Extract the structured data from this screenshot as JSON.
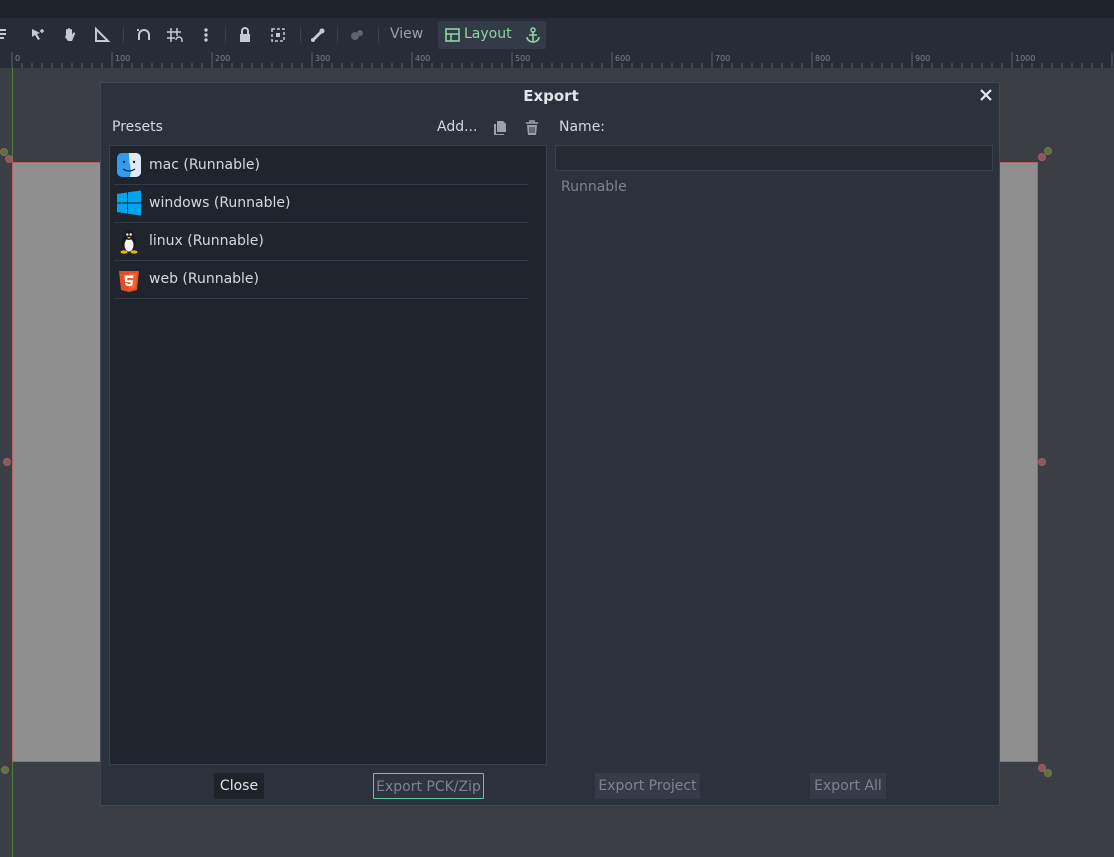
{
  "toolbar": {
    "view_label": "View",
    "layout_label": "Layout"
  },
  "ruler": {
    "ticks": [
      "0",
      "100",
      "200",
      "300",
      "400",
      "500",
      "600",
      "700",
      "800",
      "900",
      "1000"
    ]
  },
  "dialog": {
    "title": "Export",
    "presets_label": "Presets",
    "add_label": "Add...",
    "name_label": "Name:",
    "name_value": "",
    "runnable_label": "Runnable",
    "presets": [
      {
        "label": "mac (Runnable)",
        "icon": "macos-finder-icon"
      },
      {
        "label": "windows (Runnable)",
        "icon": "windows-icon"
      },
      {
        "label": "linux (Runnable)",
        "icon": "linux-tux-icon"
      },
      {
        "label": "web (Runnable)",
        "icon": "html5-icon"
      }
    ],
    "buttons": {
      "close": "Close",
      "export_pck": "Export PCK/Zip",
      "export_project": "Export Project",
      "export_all": "Export All"
    }
  },
  "colors": {
    "accent_green": "#8fd4a2",
    "focus_border": "#5fc99e",
    "dialog_bg": "#2b323c",
    "list_bg": "#20252d",
    "windows_blue": "#00a4ef",
    "html5_orange": "#e44d26"
  }
}
